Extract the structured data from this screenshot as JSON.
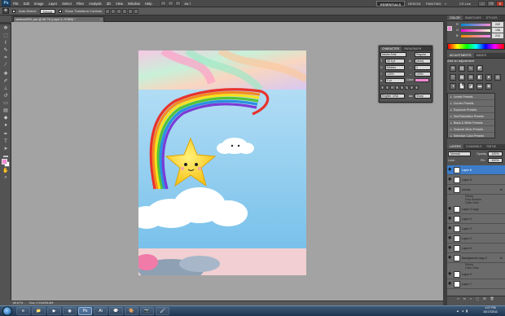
{
  "app": {
    "logo": "Ps",
    "menu": [
      "File",
      "Edit",
      "Image",
      "Layer",
      "Select",
      "Filter",
      "Analysis",
      "3D",
      "View",
      "Window",
      "Help"
    ],
    "zoom": "66.7",
    "workspaces": {
      "active": "ESSENTIALS",
      "design": "DESIGN",
      "painting": "PAINTING",
      "more": "»",
      "live": "CS Live"
    },
    "window_controls": {
      "minimize": "–",
      "restore": "❐",
      "close": "✕"
    }
  },
  "options": {
    "auto_select_label": "Auto-Select:",
    "auto_select_value": "Group",
    "transform_label": "Show Transform Controls"
  },
  "document": {
    "tab_title": "rainbow0001.psd @ 66.7% (Layer 6, RGB/8) *",
    "status_zoom": "66.67%",
    "status_doc": "Doc: 2.91M/96.8M"
  },
  "panels": {
    "color_tabs": [
      "COLOR",
      "SWATCHES",
      "STYLES"
    ],
    "rgb": [
      {
        "label": "R",
        "value": "242",
        "gradient": "linear-gradient(90deg,#008ad4,#ff8ad4)"
      },
      {
        "label": "G",
        "value": "138",
        "gradient": "linear-gradient(90deg,#f200d4,#f2ffd4)"
      },
      {
        "label": "B",
        "value": "212",
        "gradient": "linear-gradient(90deg,#f28a00,#f28aff)"
      }
    ],
    "adjust_tabs": [
      "ADJUSTMENTS",
      "MASKS"
    ],
    "adjust_title": "Add an adjustment",
    "presets": [
      "Levels Presets",
      "Curves Presets",
      "Exposure Presets",
      "Hue/Saturation Presets",
      "Black & White Presets",
      "Channel Mixer Presets",
      "Selective Color Presets"
    ],
    "layers_tabs": [
      "LAYERS",
      "CHANNELS",
      "PATHS"
    ],
    "blend_mode": "Normal",
    "opacity_label": "Opacity:",
    "opacity": "100%",
    "lock_label": "Lock:",
    "fill_label": "Fill:",
    "fill": "100%",
    "layers": [
      {
        "name": "Layer 6",
        "selected": true,
        "sub": false,
        "fx": ""
      },
      {
        "name": "Layer 5",
        "selected": false,
        "sub": false,
        "fx": ""
      },
      {
        "name": "cloudo",
        "selected": false,
        "sub": false,
        "fx": "fx"
      },
      {
        "name": "Effects",
        "selected": false,
        "sub": true,
        "fx": ""
      },
      {
        "name": "Drop Shadow",
        "selected": false,
        "sub": true,
        "fx": ""
      },
      {
        "name": "Outer Glow",
        "selected": false,
        "sub": true,
        "fx": ""
      },
      {
        "name": "Layer 4 copy",
        "selected": false,
        "sub": false,
        "fx": ""
      },
      {
        "name": "Layer 4",
        "selected": false,
        "sub": false,
        "fx": ""
      },
      {
        "name": "Layer 3",
        "selected": false,
        "sub": false,
        "fx": ""
      },
      {
        "name": "Layer 2",
        "selected": false,
        "sub": false,
        "fx": ""
      },
      {
        "name": "Layer 8",
        "selected": false,
        "sub": false,
        "fx": ""
      },
      {
        "name": "Background copy 2",
        "selected": false,
        "sub": false,
        "fx": "fx"
      },
      {
        "name": "Effects",
        "selected": false,
        "sub": true,
        "fx": ""
      },
      {
        "name": "Outer Glow",
        "selected": false,
        "sub": true,
        "fx": ""
      },
      {
        "name": "Layer 9",
        "selected": false,
        "sub": false,
        "fx": ""
      },
      {
        "name": "Layer 7",
        "selected": false,
        "sub": false,
        "fx": ""
      }
    ],
    "layers_bottom": [
      "∞",
      "fx",
      "◐",
      "▢",
      "⊞",
      "🗑"
    ]
  },
  "char_panel": {
    "tabs": [
      "CHARACTER",
      "PARAGRAPH"
    ],
    "font": "Adobe Arial",
    "style": "Regular",
    "size": "30.5 pt",
    "leading": "(Auto)",
    "kerning": "Metrics",
    "tracking": "0",
    "vscale": "100%",
    "hscale": "100%",
    "baseline": "0 pt",
    "color_label": "Color:",
    "language": "English: USA",
    "aa": "Sharp"
  },
  "taskbar": {
    "time": "1:07 PM",
    "date": "10/17/2011",
    "apps": [
      "e",
      "📁",
      "▶",
      "◉",
      "Ps",
      "Ai",
      "💬",
      "🎨",
      "📷",
      "🖌"
    ]
  },
  "colors": {
    "foreground": "#f28ad4",
    "background": "#ffffff",
    "accent": "#3d7dca"
  }
}
